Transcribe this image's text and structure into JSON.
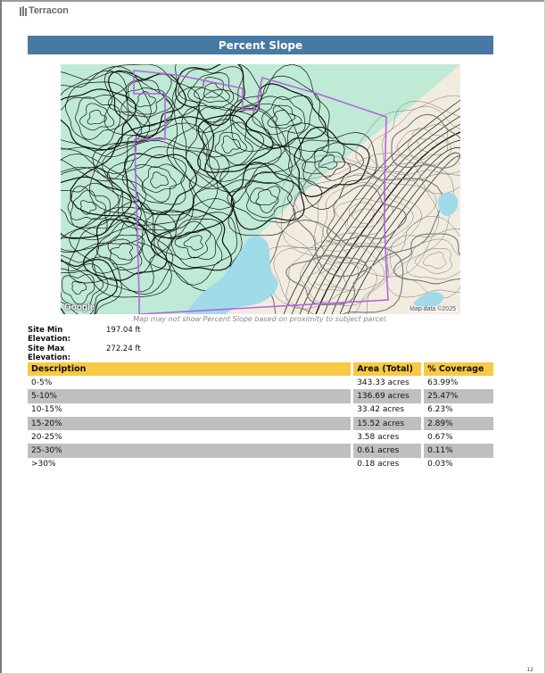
{
  "header": {
    "logo_text": "Terracon"
  },
  "section": {
    "title": "Percent Slope"
  },
  "map": {
    "attribution_google": "Google",
    "attribution_data": "Map data ©2025",
    "caption": "Map may not show Percent Slope based on proximity to subject parcel.",
    "colors": {
      "low_slope": "#bfead6",
      "high_slope": "#f2ece0",
      "water": "#9fdbe8",
      "parcel_outline": "#b464e0"
    }
  },
  "elevation": {
    "min_label": "Site Min Elevation:",
    "min_value": "197.04 ft",
    "max_label": "Site Max Elevation:",
    "max_value": "272.24 ft"
  },
  "slope_table": {
    "headers": {
      "description": "Description",
      "area": "Area (Total)",
      "coverage": "% Coverage"
    },
    "rows": [
      {
        "description": "0-5%",
        "area": "343.33 acres",
        "coverage": "63.99%"
      },
      {
        "description": "5-10%",
        "area": "136.69 acres",
        "coverage": "25.47%"
      },
      {
        "description": "10-15%",
        "area": "33.42 acres",
        "coverage": "6.23%"
      },
      {
        "description": "15-20%",
        "area": "15.52 acres",
        "coverage": "2.89%"
      },
      {
        "description": "20-25%",
        "area": "3.58 acres",
        "coverage": "0.67%"
      },
      {
        "description": "25-30%",
        "area": "0.61 acres",
        "coverage": "0.11%"
      },
      {
        "description": ">30%",
        "area": "0.18 acres",
        "coverage": "0.03%"
      }
    ]
  },
  "footer": {
    "page_number": "12"
  }
}
